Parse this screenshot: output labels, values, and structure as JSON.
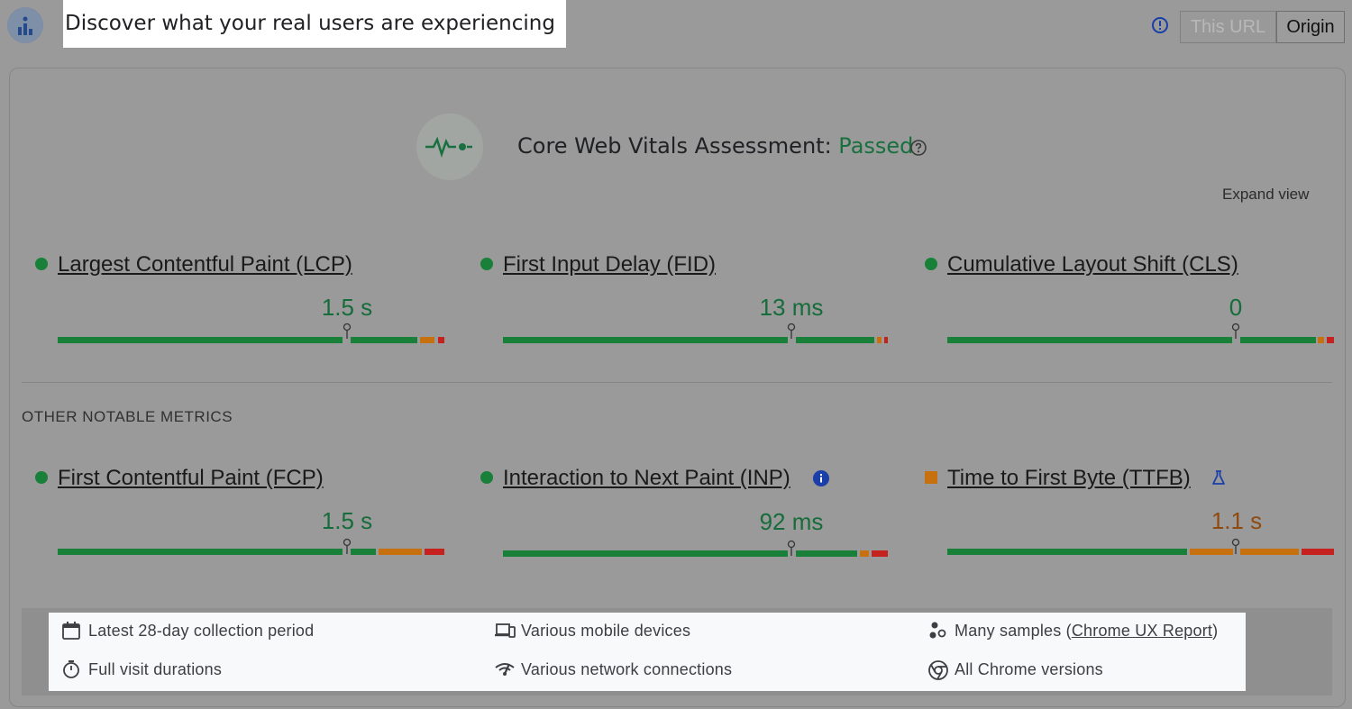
{
  "header": {
    "title": "Discover what your real users are experiencing",
    "toggle": {
      "url_label": "This URL",
      "origin_label": "Origin",
      "selected": "Origin"
    }
  },
  "assessment": {
    "label": "Core Web Vitals Assessment:",
    "status": "Passed",
    "expand_label": "Expand view"
  },
  "core_metrics": [
    {
      "name": "Largest Contentful Paint (LCP)",
      "value": "1.5 s",
      "status": "good"
    },
    {
      "name": "First Input Delay (FID)",
      "value": "13 ms",
      "status": "good"
    },
    {
      "name": "Cumulative Layout Shift (CLS)",
      "value": "0",
      "status": "good"
    }
  ],
  "other_section_label": "OTHER NOTABLE METRICS",
  "other_metrics": [
    {
      "name": "First Contentful Paint (FCP)",
      "value": "1.5 s",
      "status": "good"
    },
    {
      "name": "Interaction to Next Paint (INP)",
      "value": "92 ms",
      "status": "good"
    },
    {
      "name": "Time to First Byte (TTFB)",
      "value": "1.1 s",
      "status": "needs-improvement"
    }
  ],
  "footer": {
    "collection_period": "Latest 28-day collection period",
    "devices": "Various mobile devices",
    "samples_prefix": "Many samples (",
    "samples_link": "Chrome UX Report",
    "samples_suffix": ")",
    "durations": "Full visit durations",
    "network": "Various network connections",
    "chrome_versions": "All Chrome versions"
  },
  "colors": {
    "good": "#188038",
    "needs_improvement": "#c6700f",
    "poor": "#c5221f"
  }
}
